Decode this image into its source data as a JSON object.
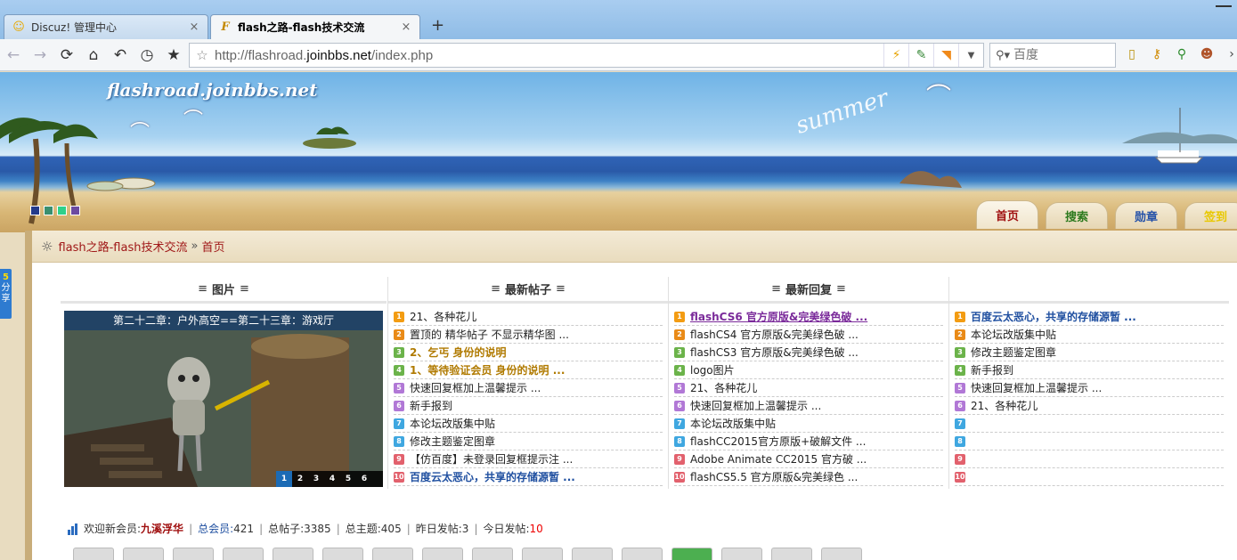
{
  "browser": {
    "tabs": [
      {
        "title": "Discuz! 管理中心",
        "close": "×"
      },
      {
        "title": "flash之路-flash技术交流",
        "close": "×"
      }
    ],
    "new_tab": "+",
    "url_host_prefix": "http://flashroad.",
    "url_host_domain": "joinbbs.net",
    "url_path": "/index.php",
    "search_placeholder": "百度"
  },
  "header": {
    "logo_text": "flashroad.joinbbs.net",
    "summer_text": "summer",
    "swatches": [
      "#233a8b",
      "#3a8f6f",
      "#2fd08a",
      "#6b4aa0"
    ],
    "tabs": [
      {
        "label": "首页",
        "color": "#a01010"
      },
      {
        "label": "搜索",
        "color": "#2d7a1e"
      },
      {
        "label": "勋章",
        "color": "#2451a8"
      },
      {
        "label": "签到",
        "color": "#e8c800"
      }
    ]
  },
  "breadcrumb": {
    "site": "flash之路-flash技术交流",
    "sep": "»",
    "current": "首页"
  },
  "share": {
    "line1": "5",
    "line2": "分",
    "line3": "享"
  },
  "columns": {
    "pics": {
      "title": "图片",
      "menu": "≡"
    },
    "latest": {
      "title": "最新帖子",
      "menu": "≡"
    },
    "replies": {
      "title": "最新回复",
      "menu": "≡"
    }
  },
  "slide": {
    "caption": "第二十二章：户外高空==第二十三章：游戏厅",
    "nums": [
      "1",
      "2",
      "3",
      "4",
      "5",
      "6"
    ]
  },
  "latest_posts": [
    {
      "n": "1",
      "t": "21、各种花儿",
      "style": ""
    },
    {
      "n": "2",
      "t": "置顶的 精华帖子 不显示精华图 ...",
      "style": ""
    },
    {
      "n": "3",
      "t": "2、乞丐 身份的说明",
      "style": "bold-gold"
    },
    {
      "n": "4",
      "t": "1、等待验证会员 身份的说明 ...",
      "style": "bold-gold"
    },
    {
      "n": "5",
      "t": "快速回复框加上温馨提示 ...",
      "style": ""
    },
    {
      "n": "6",
      "t": "新手报到",
      "style": ""
    },
    {
      "n": "7",
      "t": "本论坛改版集中贴",
      "style": ""
    },
    {
      "n": "8",
      "t": "修改主题鉴定图章",
      "style": ""
    },
    {
      "n": "9",
      "t": "【仿百度】未登录回复框提示注 ...",
      "style": ""
    },
    {
      "n": "10",
      "t": "百度云太恶心，共享的存储源暂 ...",
      "style": "bold-blue"
    }
  ],
  "latest_replies": [
    {
      "n": "1",
      "t": "flashCS6 官方原版&完美绿色破 ...",
      "style": "bold-purple"
    },
    {
      "n": "2",
      "t": "flashCS4 官方原版&完美绿色破 ...",
      "style": ""
    },
    {
      "n": "3",
      "t": "flashCS3 官方原版&完美绿色破 ...",
      "style": ""
    },
    {
      "n": "4",
      "t": "logo图片",
      "style": ""
    },
    {
      "n": "5",
      "t": "21、各种花儿",
      "style": ""
    },
    {
      "n": "6",
      "t": "快速回复框加上温馨提示 ...",
      "style": ""
    },
    {
      "n": "7",
      "t": "本论坛改版集中贴",
      "style": ""
    },
    {
      "n": "8",
      "t": "flashCC2015官方原版+破解文件 ...",
      "style": ""
    },
    {
      "n": "9",
      "t": "Adobe Animate CC2015 官方破 ...",
      "style": ""
    },
    {
      "n": "10",
      "t": "flashCS5.5 官方原版&完美绿色 ...",
      "style": ""
    }
  ],
  "fourth_column": [
    {
      "n": "1",
      "t": "百度云太恶心，共享的存储源暂 ...",
      "style": "bold-blue"
    },
    {
      "n": "2",
      "t": "本论坛改版集中贴",
      "style": ""
    },
    {
      "n": "3",
      "t": "修改主题鉴定图章",
      "style": ""
    },
    {
      "n": "4",
      "t": "新手报到",
      "style": ""
    },
    {
      "n": "5",
      "t": "快速回复框加上温馨提示 ...",
      "style": ""
    },
    {
      "n": "6",
      "t": "21、各种花儿",
      "style": ""
    },
    {
      "n": "7",
      "t": "",
      "style": ""
    },
    {
      "n": "8",
      "t": "",
      "style": ""
    },
    {
      "n": "9",
      "t": "",
      "style": ""
    },
    {
      "n": "10",
      "t": "",
      "style": ""
    }
  ],
  "stats": {
    "welcome_label": "欢迎新会员:",
    "new_member": "九溪浮华",
    "sep": "|",
    "members_label": "总会员:",
    "members": "421",
    "posts_label": "总帖子:",
    "posts": "3385",
    "topics_label": "总主题:",
    "topics": "405",
    "yesterday_label": "昨日发帖:",
    "yesterday": "3",
    "today_label": "今日发帖:",
    "today": "10"
  }
}
